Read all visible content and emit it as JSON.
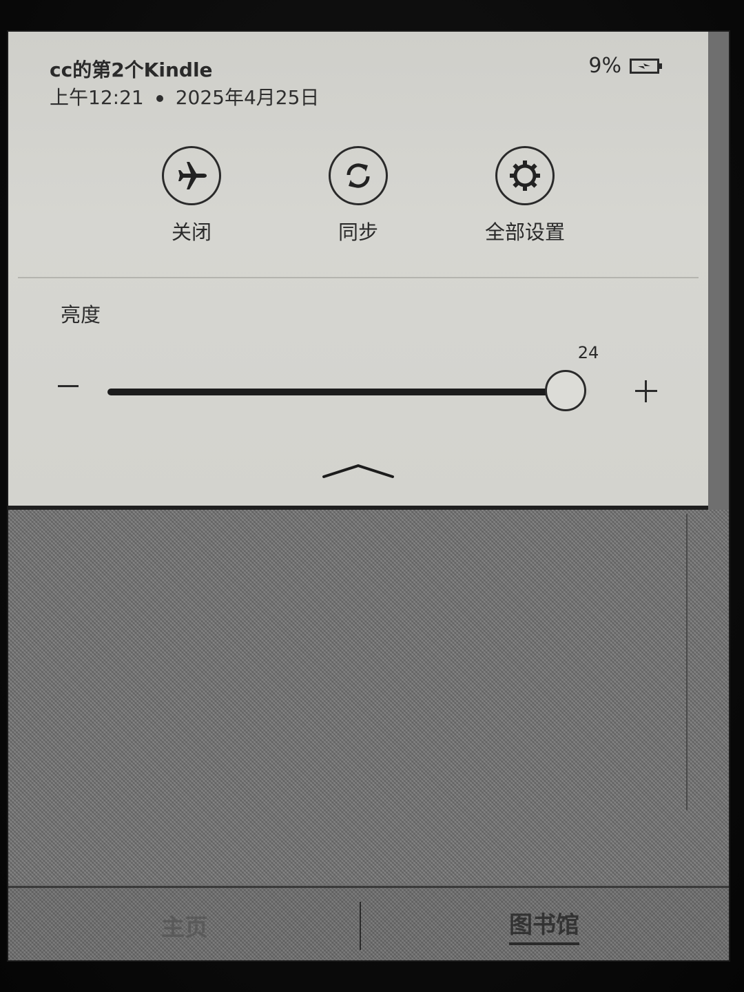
{
  "header": {
    "device_name": "cc的第2个Kindle",
    "time": "上午12:21",
    "date": "2025年4月25日",
    "battery_percent": "9%",
    "battery_charging": true
  },
  "quick_actions": [
    {
      "icon": "airplane-icon",
      "label": "关闭"
    },
    {
      "icon": "sync-icon",
      "label": "同步"
    },
    {
      "icon": "gear-icon",
      "label": "全部设置"
    }
  ],
  "brightness": {
    "title": "亮度",
    "value": "24",
    "max": 25,
    "level_fraction": 0.95
  },
  "bottom_nav": {
    "home_label": "主页",
    "library_label": "图书馆",
    "active": "library"
  }
}
